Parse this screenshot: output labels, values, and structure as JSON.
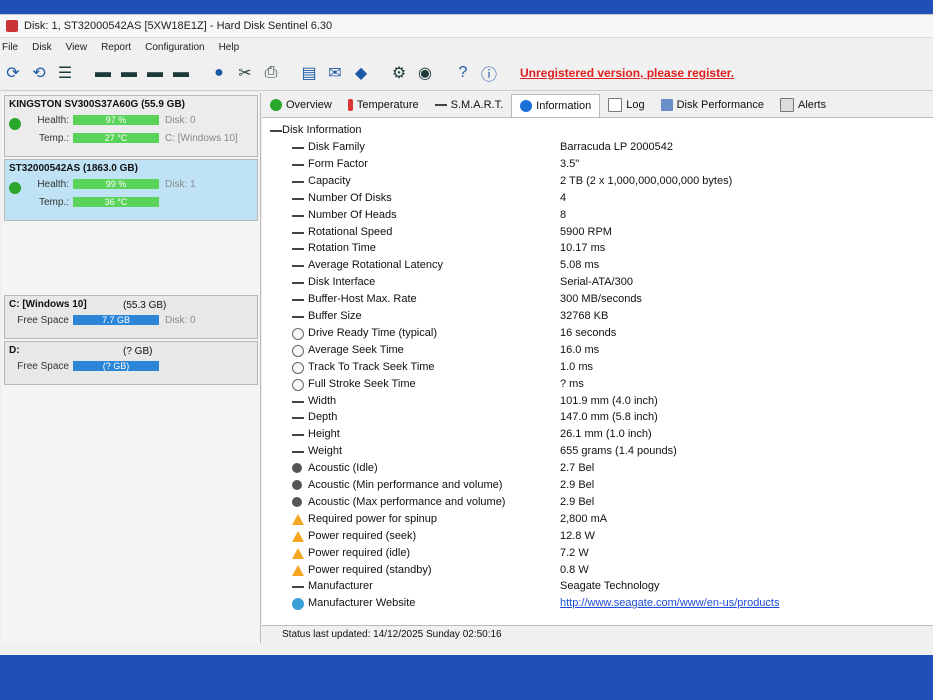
{
  "window": {
    "title": "Disk: 1, ST32000542AS [5XW18E1Z] - Hard Disk Sentinel 6.30"
  },
  "menu": [
    "File",
    "Disk",
    "View",
    "Report",
    "Configuration",
    "Help"
  ],
  "unregistered": "Unregistered version, please register.",
  "disks": [
    {
      "name": "KINGSTON SV300S37A60G (55.9 GB)",
      "health_label": "Health:",
      "health": "97 %",
      "temp_label": "Temp.:",
      "temp": "27 °C",
      "disk_label": "Disk: 0",
      "drive_label": "C: [Windows 10]",
      "selected": false
    },
    {
      "name": "ST32000542AS (1863.0 GB)",
      "health_label": "Health:",
      "health": "99 %",
      "temp_label": "Temp.:",
      "temp": "36 °C",
      "disk_label": "Disk: 1",
      "drive_label": "",
      "selected": true
    }
  ],
  "volumes": [
    {
      "name": "C: [Windows 10]",
      "size": "(55.3 GB)",
      "free_label": "Free Space",
      "free": "7.7 GB",
      "disk": "Disk: 0"
    },
    {
      "name": "D:",
      "size": "(? GB)",
      "free_label": "Free Space",
      "free": "(? GB)",
      "disk": ""
    }
  ],
  "tabs": [
    "Overview",
    "Temperature",
    "S.M.A.R.T.",
    "Information",
    "Log",
    "Disk Performance",
    "Alerts"
  ],
  "info": {
    "root": "Disk Information",
    "rows": [
      {
        "label": "Disk Family",
        "value": "Barracuda LP 2000542",
        "icon": "dash"
      },
      {
        "label": "Form Factor",
        "value": "3.5\"",
        "icon": "dash"
      },
      {
        "label": "Capacity",
        "value": "2 TB (2 x 1,000,000,000,000 bytes)",
        "icon": "dash"
      },
      {
        "label": "Number Of Disks",
        "value": "4",
        "icon": "dash"
      },
      {
        "label": "Number Of Heads",
        "value": "8",
        "icon": "dash"
      },
      {
        "label": "Rotational Speed",
        "value": "5900 RPM",
        "icon": "dash"
      },
      {
        "label": "Rotation Time",
        "value": "10.17 ms",
        "icon": "dash"
      },
      {
        "label": "Average Rotational Latency",
        "value": "5.08 ms",
        "icon": "dash"
      },
      {
        "label": "Disk Interface",
        "value": "Serial-ATA/300",
        "icon": "dash"
      },
      {
        "label": "Buffer-Host Max. Rate",
        "value": "300 MB/seconds",
        "icon": "dash"
      },
      {
        "label": "Buffer Size",
        "value": "32768 KB",
        "icon": "dash"
      },
      {
        "label": "Drive Ready Time (typical)",
        "value": "16 seconds",
        "icon": "clock"
      },
      {
        "label": "Average Seek Time",
        "value": "16.0 ms",
        "icon": "clock"
      },
      {
        "label": "Track To Track Seek Time",
        "value": "1.0 ms",
        "icon": "clock"
      },
      {
        "label": "Full Stroke Seek Time",
        "value": "? ms",
        "icon": "clock"
      },
      {
        "label": "Width",
        "value": "101.9 mm (4.0 inch)",
        "icon": "dash"
      },
      {
        "label": "Depth",
        "value": "147.0 mm (5.8 inch)",
        "icon": "dash"
      },
      {
        "label": "Height",
        "value": "26.1 mm (1.0 inch)",
        "icon": "dash"
      },
      {
        "label": "Weight",
        "value": "655 grams (1.4 pounds)",
        "icon": "dash"
      },
      {
        "label": "Acoustic (Idle)",
        "value": "2.7 Bel",
        "icon": "spk"
      },
      {
        "label": "Acoustic (Min performance and volume)",
        "value": "2.9 Bel",
        "icon": "spk"
      },
      {
        "label": "Acoustic (Max performance and volume)",
        "value": "2.9 Bel",
        "icon": "spk"
      },
      {
        "label": "Required power for spinup",
        "value": "2,800 mA",
        "icon": "warn"
      },
      {
        "label": "Power required (seek)",
        "value": "12.8 W",
        "icon": "warn"
      },
      {
        "label": "Power required (idle)",
        "value": "7.2 W",
        "icon": "warn"
      },
      {
        "label": "Power required (standby)",
        "value": "0.8 W",
        "icon": "warn"
      },
      {
        "label": "Manufacturer",
        "value": "Seagate Technology",
        "icon": "dash"
      },
      {
        "label": "Manufacturer Website",
        "value": "http://www.seagate.com/www/en-us/products",
        "icon": "globe"
      }
    ]
  },
  "status": "Status last updated: 14/12/2025 Sunday 02:50:16"
}
